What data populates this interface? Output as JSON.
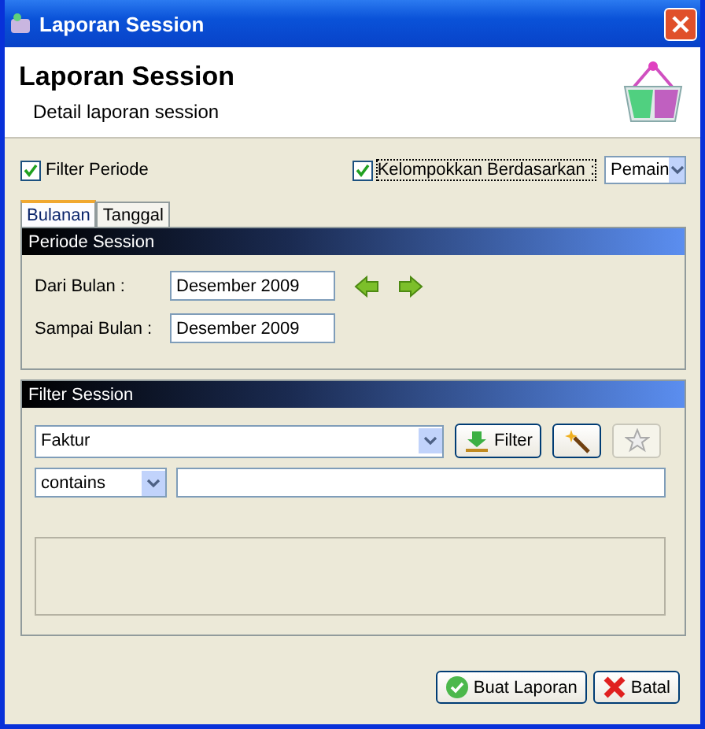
{
  "window": {
    "title": "Laporan Session"
  },
  "header": {
    "title": "Laporan Session",
    "subtitle": "Detail laporan session"
  },
  "options": {
    "filter_periode": {
      "label": "Filter Periode",
      "checked": true
    },
    "group_by": {
      "label": "Kelompokkan Berdasarkan :",
      "checked": true,
      "value": "Pemain"
    }
  },
  "tabs": [
    {
      "label": "Bulanan",
      "selected": true
    },
    {
      "label": "Tanggal",
      "selected": false
    }
  ],
  "periode_panel": {
    "title": "Periode Session",
    "fields": [
      {
        "label": "Dari Bulan :",
        "value": "Desember 2009"
      },
      {
        "label": "Sampai Bulan :",
        "value": "Desember 2009"
      }
    ]
  },
  "filter_panel": {
    "title": "Filter Session",
    "field": "Faktur",
    "filter_button": "Filter",
    "star_disabled": true,
    "operator": "contains"
  },
  "buttons": [
    {
      "label": "Buat Laporan",
      "kind": "ok"
    },
    {
      "label": "Batal",
      "kind": "cancel"
    }
  ]
}
